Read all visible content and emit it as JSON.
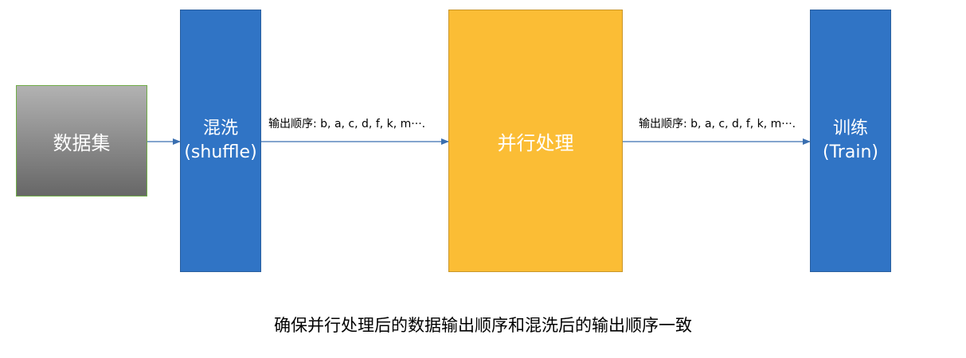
{
  "nodes": {
    "dataset": {
      "label": "数据集"
    },
    "shuffle": {
      "line1": "混洗",
      "line2": "(shuffle)"
    },
    "parallel": {
      "label": "并行处理"
    },
    "train": {
      "line1": "训练",
      "line2": "(Train)"
    }
  },
  "edges": {
    "shuffle_to_parallel": {
      "label": "输出顺序: b, a, c, d, f, k, m···."
    },
    "parallel_to_train": {
      "label": "输出顺序: b, a, c, d, f, k, m···."
    }
  },
  "caption": "确保并行处理后的数据输出顺序和混洗后的输出顺序一致",
  "colors": {
    "arrow": "#3a6fb0",
    "shuffle_fill": "#3074c5",
    "parallel_fill": "#fbbd35",
    "train_fill": "#3074c5",
    "dataset_border": "#70ad47"
  }
}
